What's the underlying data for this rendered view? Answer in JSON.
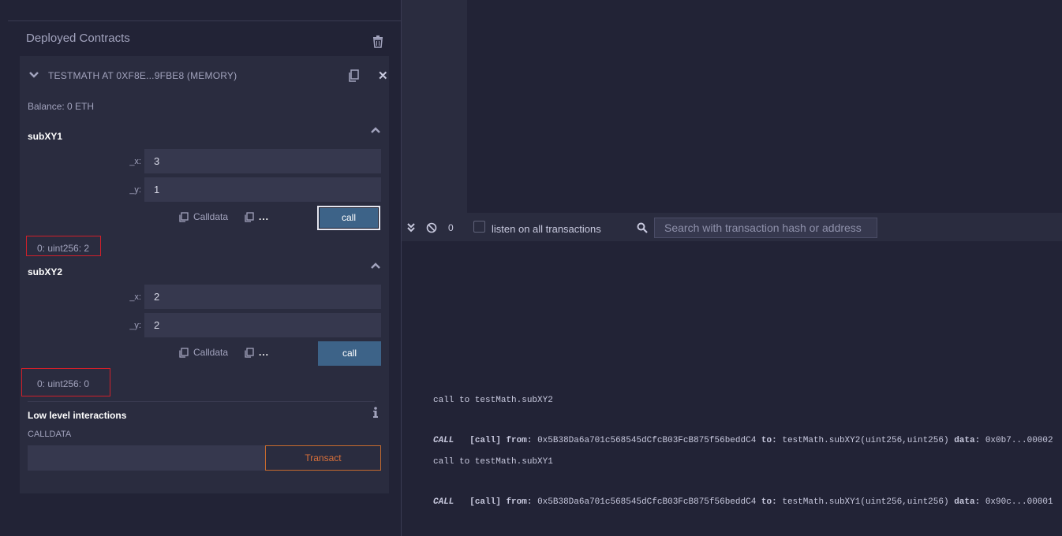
{
  "deployed": {
    "title": "Deployed Contracts",
    "contract_title": "TESTMATH AT 0XF8E...9FBE8 (MEMORY)",
    "balance": "Balance: 0 ETH",
    "functions": [
      {
        "name": "subXY1",
        "params": [
          {
            "label": "_x:",
            "value": "3"
          },
          {
            "label": "_y:",
            "value": "1"
          }
        ],
        "calldata_label": "Calldata",
        "dots": "...",
        "call_label": "call",
        "result": "0: uint256: 2"
      },
      {
        "name": "subXY2",
        "params": [
          {
            "label": "_x:",
            "value": "2"
          },
          {
            "label": "_y:",
            "value": "2"
          }
        ],
        "calldata_label": "Calldata",
        "dots": "...",
        "call_label": "call",
        "result": "0: uint256: 0"
      }
    ],
    "low_level": {
      "title": "Low level interactions",
      "calldata_label": "CALLDATA",
      "calldata_value": "",
      "transact_label": "Transact"
    }
  },
  "terminal": {
    "count": "0",
    "listen_label": "listen on all transactions",
    "search_placeholder": "Search with transaction hash or address",
    "logs": [
      {
        "summary": "call to testMath.subXY2",
        "type": "CALL",
        "tag": "[call]",
        "from_label": "from:",
        "from": "0x5B38Da6a701c568545dCfcB03FcB875f56beddC4",
        "to_label": "to:",
        "to": "testMath.subXY2(uint256,uint256)",
        "data_label": "data:",
        "data": "0x0b7...00002"
      },
      {
        "summary": "call to testMath.subXY1",
        "type": "CALL",
        "tag": "[call]",
        "from_label": "from:",
        "from": "0x5B38Da6a701c568545dCfcB03FcB875f56beddC4",
        "to_label": "to:",
        "to": "testMath.subXY1(uint256,uint256)",
        "data_label": "data:",
        "data": "0x90c...00001"
      }
    ]
  },
  "colors": {
    "background": "#222336",
    "panel": "#2a2c3f",
    "input": "#36384e",
    "call_button": "#3d6388",
    "transact_border": "#c66a2e",
    "highlight_box": "#d0202a"
  }
}
